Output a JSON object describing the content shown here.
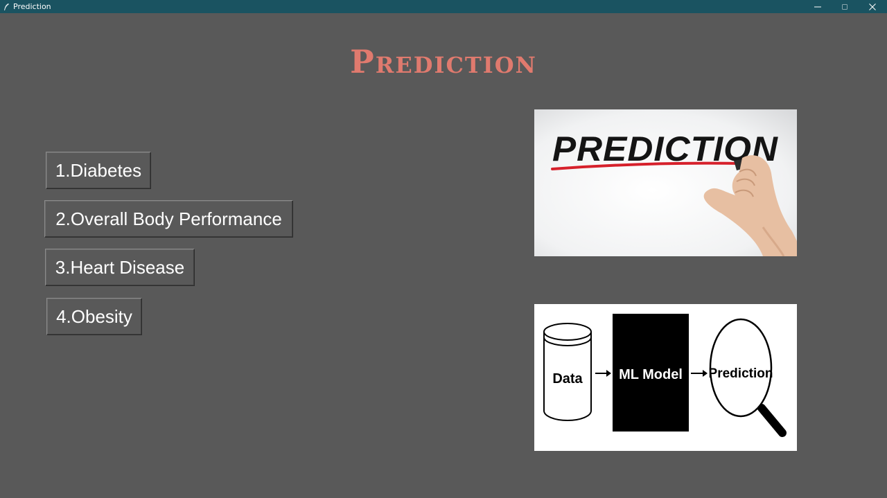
{
  "window": {
    "title": "Prediction",
    "icon": "feather-icon",
    "controls": [
      "minimize-icon",
      "maximize-icon",
      "close-icon"
    ]
  },
  "page": {
    "heading": "Prediction"
  },
  "menu": {
    "items": [
      {
        "label": "1.Diabetes"
      },
      {
        "label": "2.Overall Body Performance"
      },
      {
        "label": "3.Heart Disease"
      },
      {
        "label": "4.Obesity"
      }
    ]
  },
  "images": {
    "top": {
      "text": "PREDICTION"
    },
    "bottom": {
      "data_label": "Data",
      "model_label": "ML Model",
      "output_label": "Prediction"
    }
  },
  "colors": {
    "titlebar": "#1a5361",
    "background": "#595959",
    "heading": "#e07a6e",
    "button_text": "#ffffff"
  }
}
